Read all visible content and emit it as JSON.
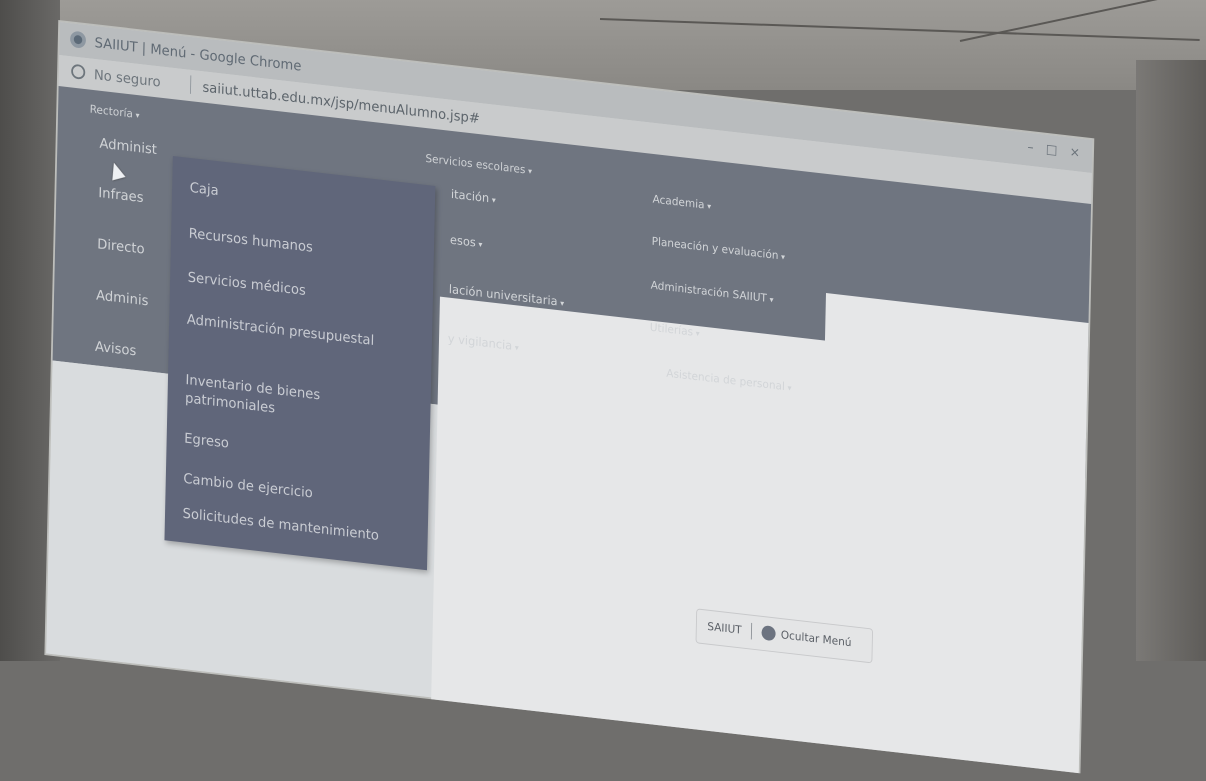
{
  "browser": {
    "window_title": "SAIIUT | Menú - Google Chrome",
    "security_label": "No seguro",
    "url": "saiiut.uttab.edu.mx/jsp/menuAlumno.jsp#"
  },
  "menu": {
    "top": [
      {
        "label": "Rectoría"
      },
      {
        "label": "Servicios escolares"
      }
    ],
    "left_column": [
      {
        "label": "Administ"
      },
      {
        "label": "Infraes"
      },
      {
        "label": "Directo"
      },
      {
        "label": "Adminis"
      },
      {
        "label": "Avisos"
      }
    ],
    "middle_column": [
      {
        "label": "itación"
      },
      {
        "label": "esos"
      },
      {
        "label": "lación universitaria"
      },
      {
        "label": "y vigilancia"
      }
    ],
    "right_column": [
      {
        "label": "Academia"
      },
      {
        "label": "Planeación y evaluación"
      },
      {
        "label": "Administración SAIIUT"
      },
      {
        "label": "Utilerías"
      },
      {
        "label": "Asistencia de personal"
      }
    ]
  },
  "dropdown": {
    "items": [
      {
        "label": "Caja"
      },
      {
        "label": "Recursos humanos"
      },
      {
        "label": "Servicios médicos"
      },
      {
        "label": "Administración presupuestal"
      },
      {
        "label": "Inventario de bienes patrimoniales"
      },
      {
        "label": "Egreso"
      },
      {
        "label": "Cambio de ejercicio"
      },
      {
        "label": "Solicitudes de mantenimiento"
      }
    ]
  },
  "footer": {
    "brand": "SAIIUT",
    "separator": "|",
    "hide_menu_label": "Ocultar Menú"
  },
  "icons": {
    "browser_logo": "chrome-icon",
    "security": "info-icon",
    "cursor": "hand-pointer-icon",
    "toggle": "toggle-circle-icon"
  },
  "colors": {
    "menu_bg": "#6f7580",
    "dropdown_bg": "#60667a",
    "page_bg": "#d9dcde"
  }
}
